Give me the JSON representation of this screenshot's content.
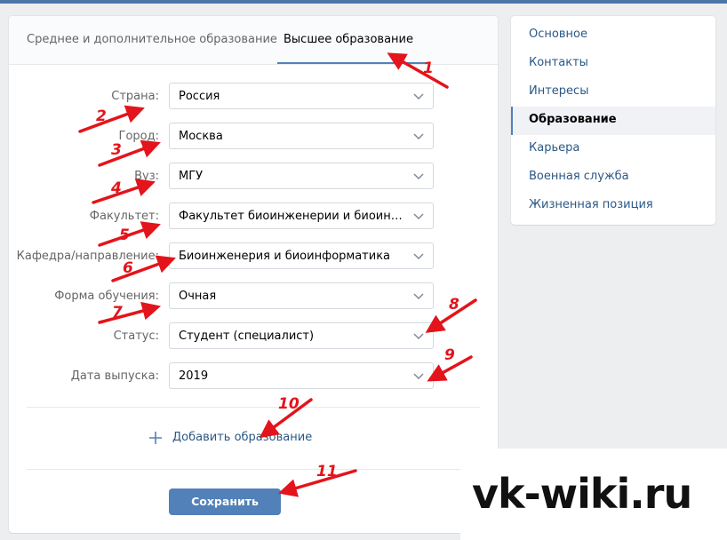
{
  "tabs": [
    {
      "label": "Среднее и дополнительное образование"
    },
    {
      "label": "Высшее образование"
    }
  ],
  "form": {
    "fields": [
      {
        "label": "Страна:",
        "value": "Россия"
      },
      {
        "label": "Город:",
        "value": "Москва"
      },
      {
        "label": "Вуз:",
        "value": "МГУ"
      },
      {
        "label": "Факультет:",
        "value": "Факультет биоинженерии и биоинформатики"
      },
      {
        "label": "Кафедра/направление:",
        "value": "Биоинженерия и биоинформатика"
      },
      {
        "label": "Форма обучения:",
        "value": "Очная"
      },
      {
        "label": "Статус:",
        "value": "Студент (специалист)"
      },
      {
        "label": "Дата выпуска:",
        "value": "2019"
      }
    ],
    "add_label": "Добавить образование",
    "save_label": "Сохранить"
  },
  "sidebar": {
    "items": [
      {
        "label": "Основное"
      },
      {
        "label": "Контакты"
      },
      {
        "label": "Интересы"
      },
      {
        "label": "Образование"
      },
      {
        "label": "Карьера"
      },
      {
        "label": "Военная служба"
      },
      {
        "label": "Жизненная позиция"
      }
    ]
  },
  "annotations": [
    "1",
    "2",
    "3",
    "4",
    "5",
    "6",
    "7",
    "8",
    "9",
    "10",
    "11"
  ],
  "watermark": "vk-wiki.ru",
  "colors": {
    "accent": "#5181b8",
    "link": "#2a5885",
    "arrow": "#e3141b"
  }
}
